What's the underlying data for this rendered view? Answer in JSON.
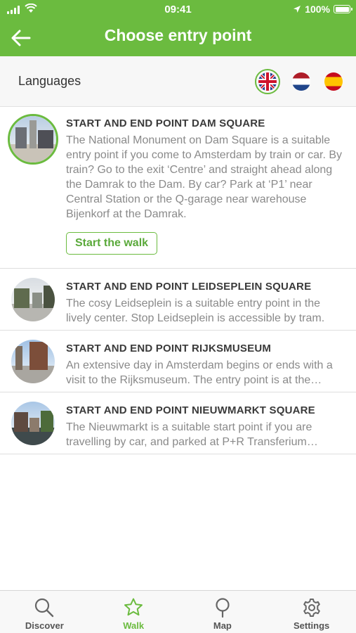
{
  "status_bar": {
    "time": "09:41",
    "battery": "100%"
  },
  "header": {
    "title": "Choose entry point",
    "back_icon": "arrow-left-icon"
  },
  "languages": {
    "label": "Languages",
    "options": [
      {
        "icon": "flag-uk-icon",
        "selected": true
      },
      {
        "icon": "flag-nl-icon",
        "selected": false
      },
      {
        "icon": "flag-es-icon",
        "selected": false
      }
    ]
  },
  "entry_points": [
    {
      "title": "START AND END POINT DAM SQUARE",
      "description": "The National Monument on Dam Square is a suitable entry point if you come to Amsterdam by train or car. By train? Go to the exit ‘Centre’ and straight ahead along the Damrak to the Dam. By car? Park at ‘P1’ near Central Station or the Q-garage near warehouse Bijenkorf at the Damrak.",
      "button": "Start the walk",
      "expanded": true
    },
    {
      "title": "START AND END POINT LEIDSEPLEIN SQUARE",
      "description": "The cosy Leidseplein is a suitable entry point in the lively center. Stop Leidseplein is accessible by tram.",
      "expanded": false
    },
    {
      "title": "START AND END POINT RIJKSMUSEUM",
      "description": "An extensive day in Amsterdam begins or ends with a visit to the Rijksmuseum. The entry point is at the museum.",
      "expanded": false
    },
    {
      "title": "START AND END POINT NIEUWMARKT SQUARE",
      "description": "The Nieuwmarkt is a suitable start point if you are travelling by car, and parked at P+R Transferium Zeeburg.",
      "expanded": false
    }
  ],
  "tabbar": {
    "tabs": [
      {
        "label": "Discover",
        "icon": "search-icon",
        "active": false
      },
      {
        "label": "Walk",
        "icon": "star-icon",
        "active": true
      },
      {
        "label": "Map",
        "icon": "map-pin-icon",
        "active": false
      },
      {
        "label": "Settings",
        "icon": "gear-icon",
        "active": false
      }
    ]
  },
  "colors": {
    "accent": "#6bbb3f",
    "title_text": "#3a3a3a",
    "description_text": "#8a8a8a"
  }
}
